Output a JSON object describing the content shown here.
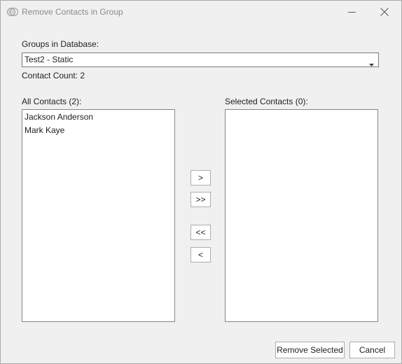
{
  "window": {
    "title": "Remove Contacts in Group",
    "app_icon": "intersecting-circles-icon",
    "minimize_icon": "minimize-icon",
    "close_icon": "close-icon"
  },
  "groups": {
    "label": "Groups in Database:",
    "selected_value": "Test2 - Static",
    "dropdown_icon": "chevron-down-icon"
  },
  "contact_count": {
    "text": "Contact Count: 2"
  },
  "all_contacts": {
    "label": "All Contacts (2):",
    "items": [
      "Jackson Anderson",
      "Mark Kaye"
    ]
  },
  "selected_contacts": {
    "label": "Selected Contacts (0):",
    "items": []
  },
  "move_buttons": {
    "add_one": ">",
    "add_all": ">>",
    "remove_all": "<<",
    "remove_one": "<"
  },
  "actions": {
    "remove_selected": "Remove Selected",
    "cancel": "Cancel"
  },
  "colors": {
    "window_background": "#f0f0f0",
    "title_text": "#8a8a8a",
    "border": "#adadad"
  }
}
